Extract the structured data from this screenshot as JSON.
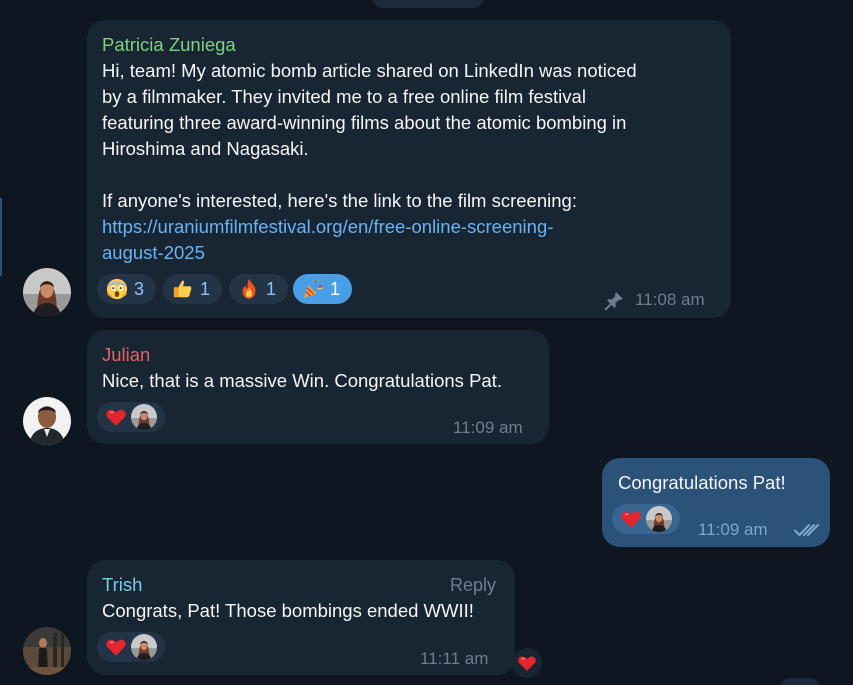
{
  "messages": [
    {
      "sender": "Patricia Zuniega",
      "sender_color": "#7fd17f",
      "lines": [
        "Hi, team! My atomic bomb article shared on LinkedIn was noticed",
        "by a filmmaker. They invited me to a free online film festival",
        "featuring three award-winning films about the atomic bombing in",
        "Hiroshima and Nagasaki.",
        "",
        "If anyone's interested, here's the link to the film screening:"
      ],
      "link_lines": [
        "https://uraniumfilmfestival.org/en/free-online-screening-",
        "august-2025"
      ],
      "reactions": [
        {
          "emoji": "scream-emoji",
          "count": "3"
        },
        {
          "emoji": "thumbs-up-emoji",
          "count": "1"
        },
        {
          "emoji": "fire-emoji",
          "count": "1"
        },
        {
          "emoji": "party-popper-emoji",
          "count": "1"
        }
      ],
      "time": "11:08 am",
      "pinned": true
    },
    {
      "sender": "Julian",
      "sender_color": "#e8606a",
      "text": "Nice, that is a massive Win. Congratulations Pat.",
      "reaction": "heart-emoji",
      "time": "11:09 am"
    },
    {
      "text": "Congratulations Pat!",
      "reaction": "heart-emoji",
      "time": "11:09 am",
      "status": "read",
      "outgoing": true
    },
    {
      "sender": "Trish",
      "sender_color": "#6fd0e8",
      "text": "Congrats, Pat! Those bombings ended WWII!",
      "reply_label": "Reply",
      "reaction": "heart-emoji",
      "time": "11:11 am"
    }
  ],
  "colors": {
    "background": "#0e1621",
    "incoming_bubble": "#182533",
    "outgoing_bubble": "#2b5278",
    "link": "#6ab3f3",
    "meta_text": "#6d7f8f"
  }
}
